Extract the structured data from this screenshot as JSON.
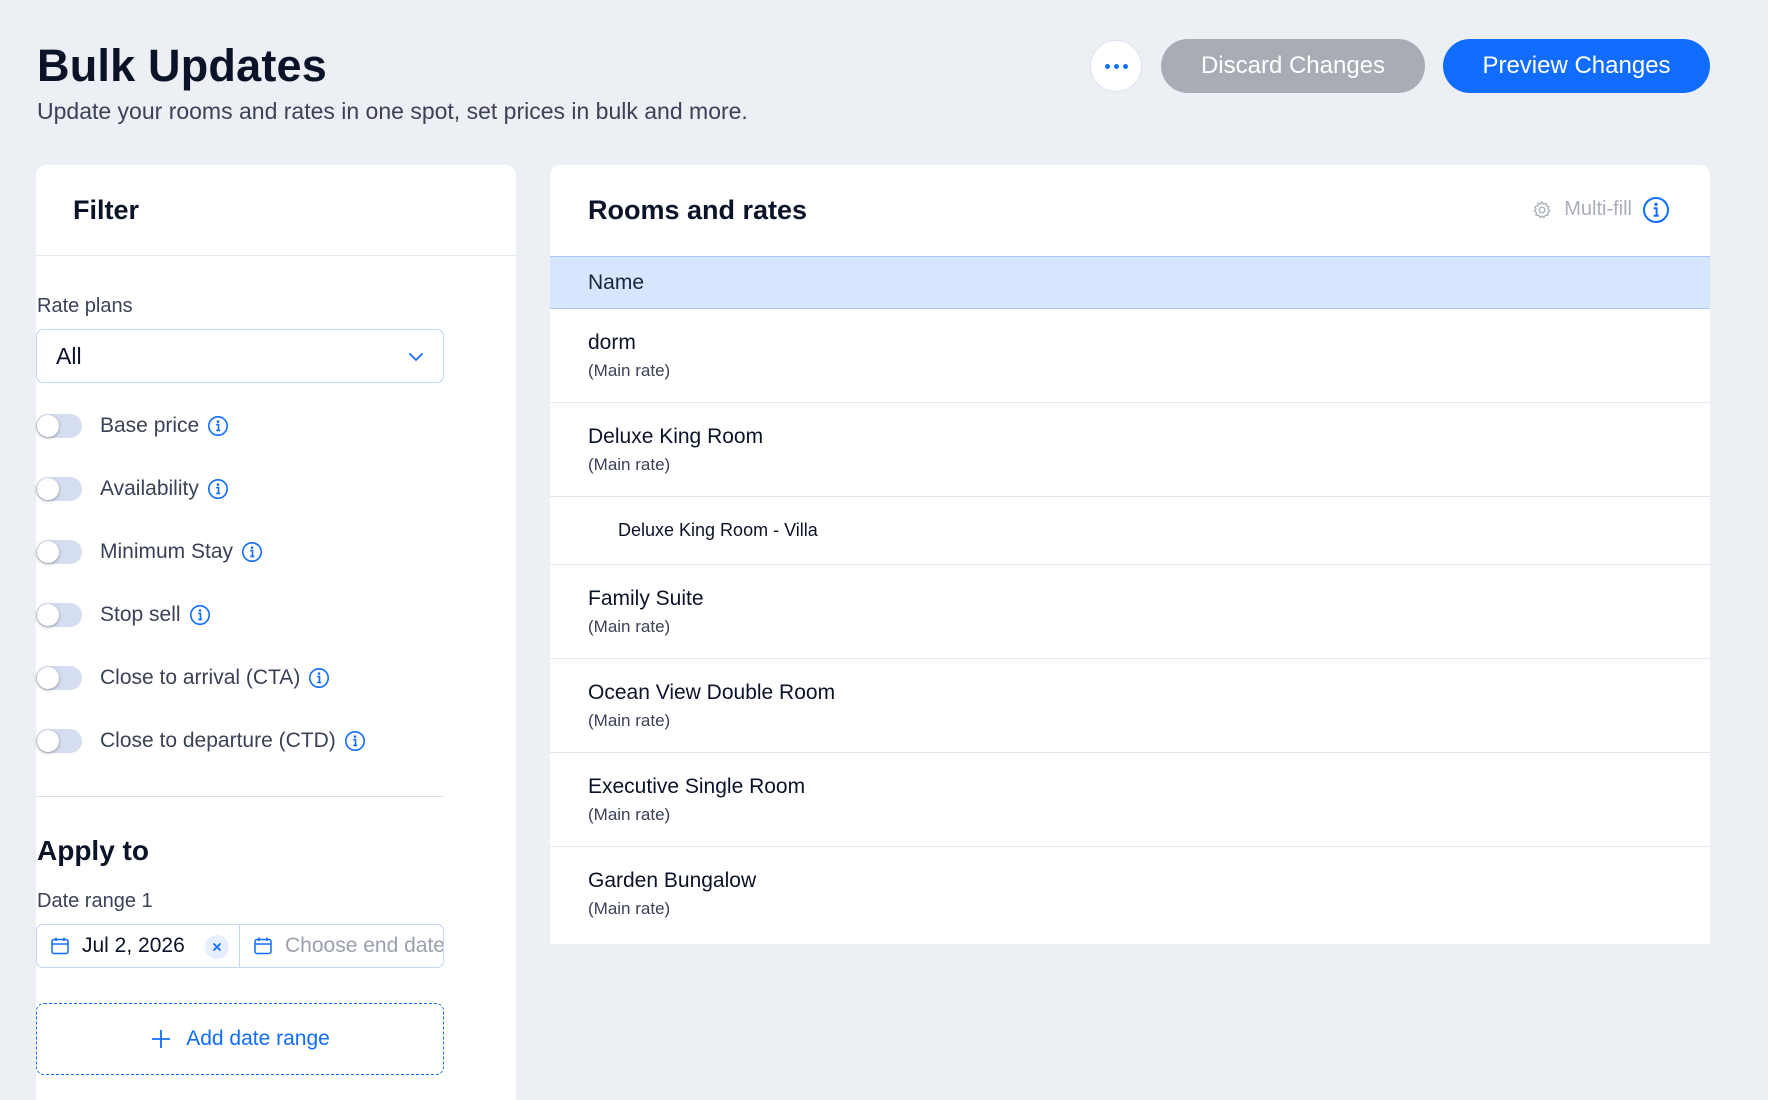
{
  "header": {
    "title": "Bulk Updates",
    "subtitle": "Update your rooms and rates in one spot, set prices in bulk and more.",
    "discard_label": "Discard Changes",
    "preview_label": "Preview Changes"
  },
  "filter": {
    "title": "Filter",
    "rate_plans_label": "Rate plans",
    "rate_plans_value": "All",
    "toggles": [
      {
        "label": "Base price",
        "on": false
      },
      {
        "label": "Availability",
        "on": false
      },
      {
        "label": "Minimum Stay",
        "on": false
      },
      {
        "label": "Stop sell",
        "on": false
      },
      {
        "label": "Close to arrival (CTA)",
        "on": false
      },
      {
        "label": "Close to departure (CTD)",
        "on": false
      }
    ],
    "apply_to_title": "Apply to",
    "date_range_label": "Date range 1",
    "start_date": "Jul 2, 2026",
    "end_date_placeholder": "Choose end date",
    "add_date_range_label": "Add date range"
  },
  "rooms": {
    "title": "Rooms and rates",
    "multi_fill_label": "Multi-fill",
    "column_name": "Name",
    "rows": [
      {
        "name": "dorm",
        "rate": "(Main rate)"
      },
      {
        "name": "Deluxe King Room",
        "rate": "(Main rate)"
      },
      {
        "name": "Deluxe King Room - Villa"
      },
      {
        "name": "Family Suite",
        "rate": "(Main rate)"
      },
      {
        "name": "Ocean View Double Room",
        "rate": "(Main rate)"
      },
      {
        "name": "Executive Single Room",
        "rate": "(Main rate)"
      },
      {
        "name": "Garden Bungalow",
        "rate": "(Main rate)"
      }
    ]
  },
  "colors": {
    "accent": "#116DFF",
    "background": "#ECEFF4",
    "discard_button": "#A8ACB5",
    "table_header": "#D6E6FE"
  },
  "icons": {
    "more": "more-dots-icon",
    "info": "info-icon",
    "dropdown": "chevron-down-icon",
    "calendar": "calendar-icon",
    "clear": "close-icon",
    "add": "plus-icon",
    "multi_fill": "gear-icon"
  }
}
